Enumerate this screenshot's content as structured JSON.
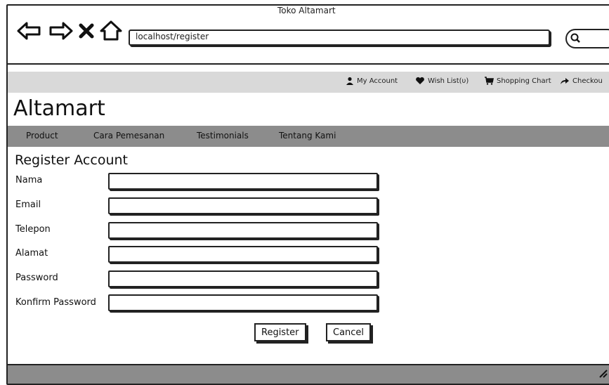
{
  "window": {
    "title": "Toko Altamart"
  },
  "toolbar": {
    "back_icon": "back-arrow-icon",
    "forward_icon": "forward-arrow-icon",
    "stop_icon": "close-icon",
    "home_icon": "home-icon",
    "url": "localhost/register",
    "search_icon": "search-icon"
  },
  "account_bar": {
    "my_account": "My Account",
    "wish_list": "Wish List(υ)",
    "shopping_chart": "Shopping Chart",
    "checkout": "Checkou"
  },
  "brand": "Altamart",
  "menu": {
    "items": [
      "Product",
      "Cara Pemesanan",
      "Testimonials",
      "Tentang Kami"
    ]
  },
  "form": {
    "title": "Register Account",
    "fields": [
      {
        "label": "Nama",
        "value": ""
      },
      {
        "label": "Email",
        "value": ""
      },
      {
        "label": "Telepon",
        "value": ""
      },
      {
        "label": "Alamat",
        "value": ""
      },
      {
        "label": "Password",
        "value": ""
      },
      {
        "label": "Konfirm Password",
        "value": ""
      }
    ],
    "register_label": "Register",
    "cancel_label": "Cancel"
  },
  "colors": {
    "strip": "#d9d9d9",
    "menu_bar": "#8c8c8c",
    "status_bar": "#8c8c8c",
    "border": "#222222"
  }
}
